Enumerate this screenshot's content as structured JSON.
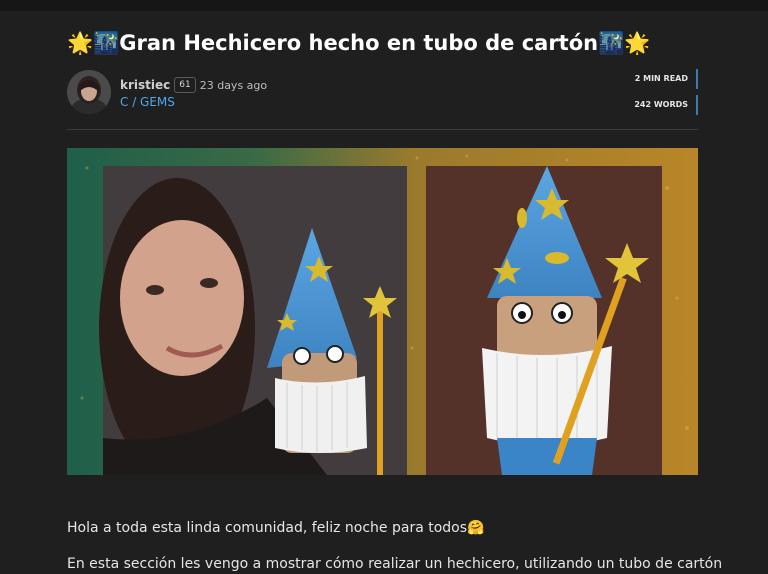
{
  "post": {
    "title": "🌟🌃Gran Hechicero hecho en tubo de cartón🌃🌟",
    "author": "kristiec",
    "reputation": "61",
    "time_ago": "23 days ago",
    "community": "C / GEMS",
    "read_time": "2 MIN READ",
    "word_count": "242 WORDS"
  },
  "body": {
    "paragraph_1": "Hola a toda esta linda comunidad, feliz noche para todos🤗",
    "paragraph_2": "En esta sección les vengo a mostrar cómo realizar un hechicero, utilizando un tubo de cartón"
  },
  "colors": {
    "background": "#1f1f1f",
    "link": "#4ea7e8",
    "meta_accent": "#3b7ab3",
    "hat_blue": "#4b9ad8",
    "star_gold": "#d4b62a"
  },
  "icons": {
    "avatar": "avatar-photo",
    "hero": "wizard-photo-collage"
  }
}
